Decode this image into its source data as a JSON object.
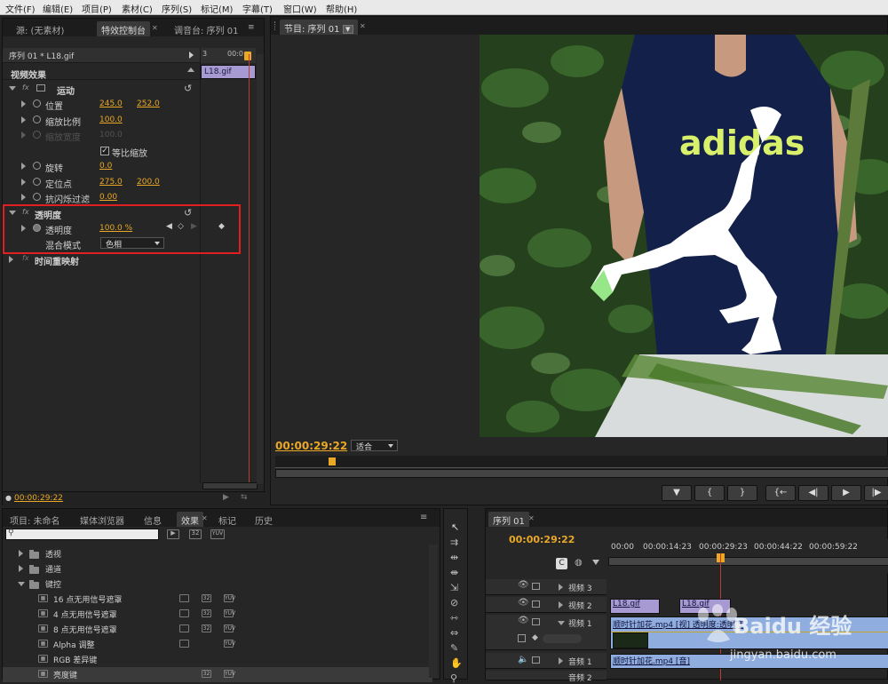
{
  "menu": [
    "文件(F)",
    "编辑(E)",
    "项目(P)",
    "素材(C)",
    "序列(S)",
    "标记(M)",
    "字幕(T)",
    "窗口(W)",
    "帮助(H)"
  ],
  "effect_controls": {
    "tabs": [
      "源: (无素材)",
      "特效控制台",
      "调音台: 序列 01"
    ],
    "clip_path": "序列 01 * L18.gif",
    "ruler_labels": [
      "3",
      "00:0"
    ],
    "timeline_clip_label": "L18.gif",
    "section_video": "视频效果",
    "motion": "运动",
    "props": {
      "position": {
        "label": "位置",
        "x": "245.0",
        "y": "252.0"
      },
      "scale": {
        "label": "缩放比例",
        "value": "100.0"
      },
      "scale_width": {
        "label": "缩放宽度",
        "value": "100.0"
      },
      "uniform": "等比缩放",
      "rotation": {
        "label": "旋转",
        "value": "0.0"
      },
      "anchor": {
        "label": "定位点",
        "x": "275.0",
        "y": "200.0"
      },
      "antiflicker": {
        "label": "抗闪烁过滤",
        "value": "0.00"
      }
    },
    "opacity_section": "透明度",
    "opacity": {
      "label": "透明度",
      "value": "100.0 %"
    },
    "blend": {
      "label": "混合模式",
      "value": "色相"
    },
    "time_remap": "时间重映射",
    "timecode": "00:00:29:22"
  },
  "program": {
    "tab": "节目: 序列 01",
    "timecode": "00:00:29:22",
    "fit": "适合",
    "transport": [
      "▼",
      "{",
      "}",
      "{←",
      "◀|",
      "▶",
      "|▶"
    ]
  },
  "project": {
    "tabs": [
      "项目: 未命名",
      "媒体浏览器",
      "信息",
      "效果",
      "标记",
      "历史"
    ],
    "search_placeholder": "",
    "badge_labels": [
      "32",
      "YUV"
    ],
    "folders": [
      "透视",
      "通道",
      "键控"
    ],
    "items": [
      "16 点无用信号遮罩",
      "4 点无用信号遮罩",
      "8 点无用信号遮罩",
      "Alpha 调整",
      "RGB 差异键",
      "亮度键"
    ]
  },
  "timeline": {
    "tab": "序列 01",
    "timecode": "00:00:29:22",
    "ruler": [
      "00:00",
      "00:00:14:23",
      "00:00:29:23",
      "00:00:44:22",
      "00:00:59:22"
    ],
    "tracks": {
      "v3": "视频 3",
      "v2": "视频 2",
      "v1": "视频 1",
      "a1": "音频 1",
      "a2": "音频 2"
    },
    "clips": {
      "v2a": "L18.gif",
      "v2b": "L18.gif",
      "v1": "顺时针加花.mp4 [视] 透明度:透明度",
      "a1": "顺时针加花.mp4 [音]"
    }
  },
  "watermark": {
    "brand": "Baidu 经验",
    "url": "jingyan.baidu.com"
  }
}
